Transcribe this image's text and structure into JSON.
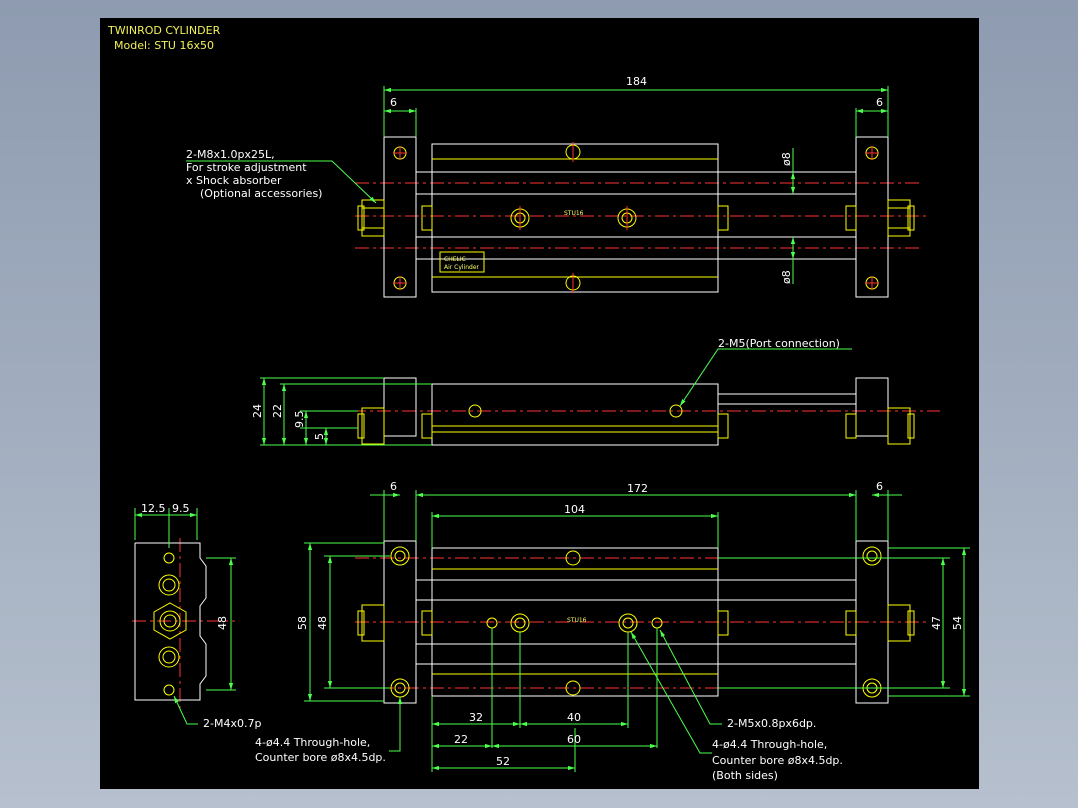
{
  "title": {
    "line1": "TWINROD CYLINDER",
    "line2": "Model: STU 16x50"
  },
  "labels": {
    "body_mark": "STU16",
    "brand": "CHELIC",
    "brand_sub": "Air Cylinder"
  },
  "dimensions": {
    "top_total": "184",
    "top_left": "6",
    "top_right": "6",
    "rod_dia_upper": "ø8",
    "rod_dia_lower": "ø8",
    "side_24": "24",
    "side_22": "22",
    "side_9_5": "9.5",
    "side_5": "5",
    "bottom_left": "6",
    "bottom_total": "172",
    "bottom_right": "6",
    "bottom_body": "104",
    "end_12_5": "12.5",
    "end_9_5": "9.5",
    "end_48": "48",
    "bottom_58": "58",
    "bottom_48": "48",
    "bottom_47": "47",
    "bottom_54": "54",
    "bottom_32": "32",
    "bottom_40": "40",
    "bottom_22": "22",
    "bottom_60": "60",
    "bottom_52": "52"
  },
  "notes": {
    "stroke_l1": "2-M8x1.0px25L,",
    "stroke_l2": "For stroke adjustment",
    "stroke_l3": "x Shock absorber",
    "stroke_l4": "(Optional accessories)",
    "port": "2-M5(Port connection)",
    "m4": "2-M4x0.7p",
    "left_hole_l1": "4-ø4.4 Through-hole,",
    "left_hole_l2": "Counter bore ø8x4.5dp.",
    "m5": "2-M5x0.8px6dp.",
    "right_hole_l1": "4-ø4.4 Through-hole,",
    "right_hole_l2": "Counter bore ø8x4.5dp.",
    "right_hole_l3": "(Both sides)"
  },
  "colors": {
    "background": "#000000",
    "outline": "#ffffff",
    "dimension": "#4cff4c",
    "center": "#ff3333",
    "part": "#ffff66"
  }
}
